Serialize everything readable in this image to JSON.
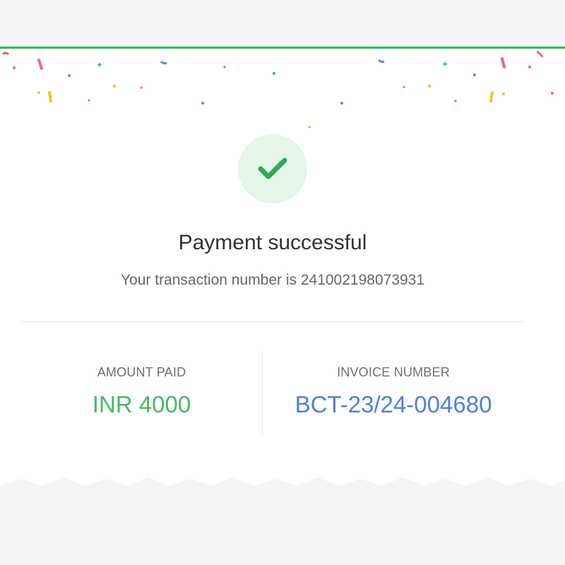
{
  "status": {
    "title": "Payment successful",
    "transaction_text": "Your transaction number is 241002198073931",
    "icon": "checkmark-icon"
  },
  "details": {
    "amount_label": "AMOUNT PAID",
    "amount_value": "INR 4000",
    "invoice_label": "INVOICE NUMBER",
    "invoice_value": "BCT-23/24-004680"
  },
  "colors": {
    "success_green": "#2eb85c",
    "amount_green": "#48b864",
    "invoice_blue": "#4f7fe0",
    "check_circle_bg": "#e5f6e9"
  }
}
